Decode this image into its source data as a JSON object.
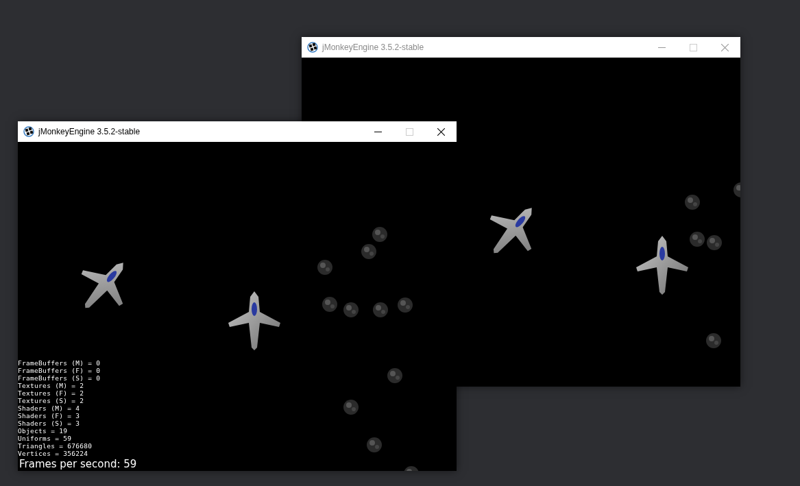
{
  "windows": [
    {
      "title": "jMonkeyEngine 3.5.2-stable",
      "active": false
    },
    {
      "title": "jMonkeyEngine 3.5.2-stable",
      "active": true,
      "stats": [
        "FrameBuffers (M) = 0",
        "FrameBuffers (F) = 0",
        "FrameBuffers (S) = 0",
        "Textures (M) = 2",
        "Textures (F) = 2",
        "Textures (S) = 2",
        "Shaders (M) = 4",
        "Shaders (F) = 3",
        "Shaders (S) = 3",
        "Objects = 19",
        "Uniforms = 59",
        "Triangles = 676680",
        "Vertices = 356224"
      ],
      "fps": "Frames per second: 59"
    }
  ]
}
